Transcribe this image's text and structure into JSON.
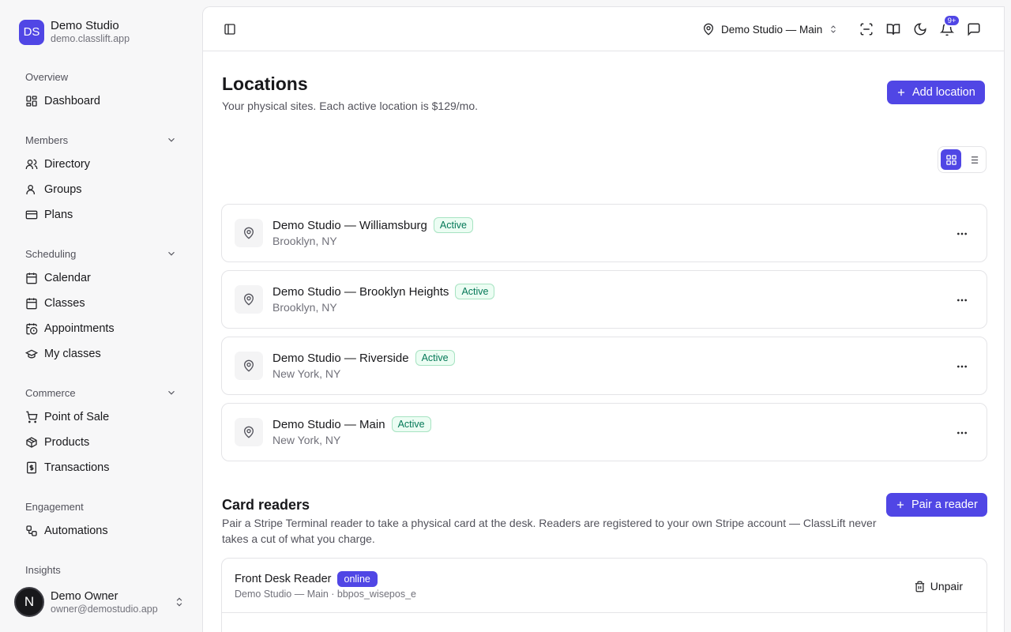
{
  "brand": {
    "initials": "DS",
    "name": "Demo Studio",
    "url": "demo.classlift.app"
  },
  "sidebar": {
    "overview": {
      "heading": "Overview",
      "items": [
        {
          "label": "Dashboard",
          "icon": "dashboard-icon"
        }
      ]
    },
    "members": {
      "heading": "Members",
      "items": [
        {
          "label": "Directory",
          "icon": "users-icon"
        },
        {
          "label": "Groups",
          "icon": "user-icon"
        },
        {
          "label": "Plans",
          "icon": "credit-card-icon"
        }
      ]
    },
    "scheduling": {
      "heading": "Scheduling",
      "items": [
        {
          "label": "Calendar",
          "icon": "calendar-icon"
        },
        {
          "label": "Classes",
          "icon": "calendar-icon"
        },
        {
          "label": "Appointments",
          "icon": "calendar-clock-icon"
        },
        {
          "label": "My classes",
          "icon": "graduation-cap-icon"
        }
      ]
    },
    "commerce": {
      "heading": "Commerce",
      "items": [
        {
          "label": "Point of Sale",
          "icon": "cart-icon"
        },
        {
          "label": "Products",
          "icon": "package-icon"
        },
        {
          "label": "Transactions",
          "icon": "receipt-dollar-icon"
        }
      ]
    },
    "engagement": {
      "heading": "Engagement",
      "items": [
        {
          "label": "Automations",
          "icon": "workflow-icon"
        }
      ]
    },
    "insights": {
      "heading": "Insights"
    }
  },
  "user": {
    "initial": "N",
    "name": "Demo Owner",
    "email": "owner@demostudio.app"
  },
  "topbar": {
    "location_label": "Demo Studio — Main",
    "notifications_badge": "9+"
  },
  "page": {
    "title": "Locations",
    "subtitle": "Your physical sites. Each active location is $129/mo.",
    "add_button": "Add location"
  },
  "locations": [
    {
      "name": "Demo Studio — Williamsburg",
      "status": "Active",
      "city": "Brooklyn, NY"
    },
    {
      "name": "Demo Studio — Brooklyn Heights",
      "status": "Active",
      "city": "Brooklyn, NY"
    },
    {
      "name": "Demo Studio — Riverside",
      "status": "Active",
      "city": "New York, NY"
    },
    {
      "name": "Demo Studio — Main",
      "status": "Active",
      "city": "New York, NY"
    }
  ],
  "card_readers": {
    "title": "Card readers",
    "description": "Pair a Stripe Terminal reader to take a physical card at the desk. Readers are registered to your own Stripe account — ClassLift never takes a cut of what you charge.",
    "pair_button": "Pair a reader",
    "readers": [
      {
        "name": "Front Desk Reader",
        "status": "online",
        "meta": "Demo Studio — Main · bbpos_wisepos_e",
        "unpair_label": "Unpair"
      }
    ]
  },
  "colors": {
    "accent": "#5046e5",
    "active_badge_text": "#047857",
    "active_badge_bg": "#ecfdf3"
  }
}
